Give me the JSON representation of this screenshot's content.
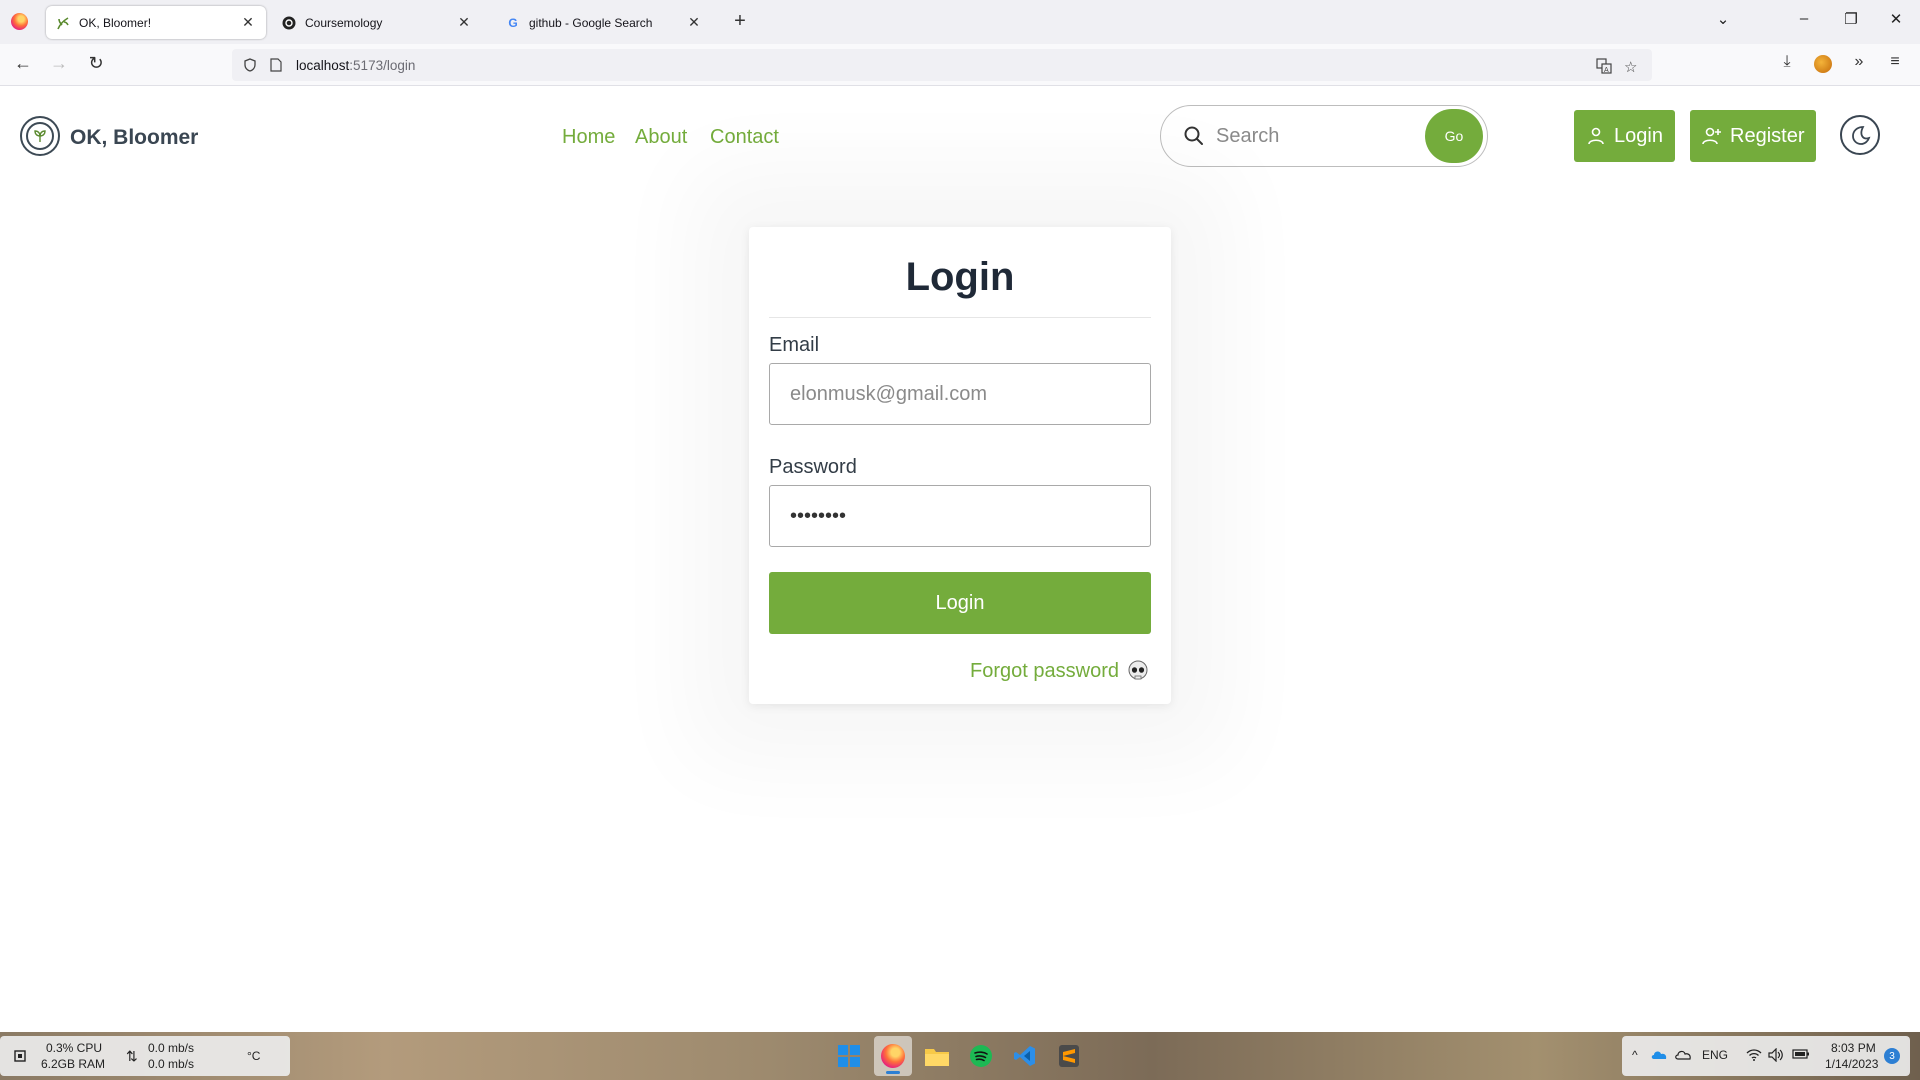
{
  "browser": {
    "tabs": [
      {
        "label": "OK, Bloomer!",
        "favicon": "plant-icon",
        "active": true
      },
      {
        "label": "Coursemology",
        "favicon": "coursemology-icon",
        "active": false
      },
      {
        "label": "github - Google Search",
        "favicon": "google-icon",
        "active": false
      }
    ],
    "url_host": "localhost",
    "url_path": ":5173/login"
  },
  "header": {
    "brand": "OK, Bloomer",
    "nav": [
      {
        "label": "Home"
      },
      {
        "label": "About"
      },
      {
        "label": "Contact"
      }
    ],
    "search": {
      "placeholder": "Search",
      "button_label": "Go"
    },
    "login_label": "Login",
    "register_label": "Register"
  },
  "login_card": {
    "title": "Login",
    "email_label": "Email",
    "email_placeholder": "elonmusk@gmail.com",
    "password_label": "Password",
    "password_value": "••••••••",
    "submit_label": "Login",
    "forgot_label": "Forgot password"
  },
  "taskbar": {
    "cpu": "0.3% CPU",
    "ram": "6.2GB RAM",
    "net_up": "0.0 mb/s",
    "net_down": "0.0 mb/s",
    "temp": "°C",
    "lang": "ENG",
    "time": "8:03 PM",
    "date": "1/14/2023",
    "notifications": "3"
  },
  "colors": {
    "accent": "#74ac3c",
    "text_dark": "#1f2937",
    "brand_text": "#3a4652"
  }
}
